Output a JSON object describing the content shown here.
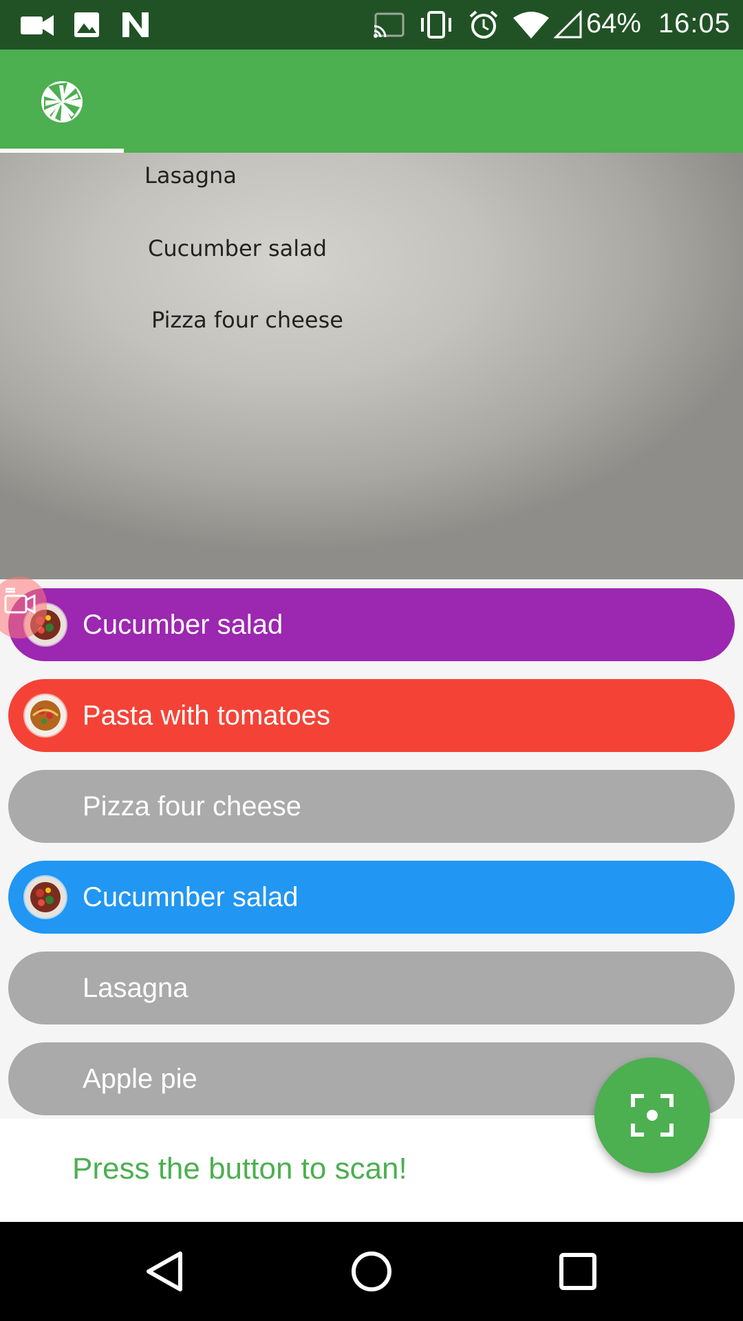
{
  "status_bar": {
    "battery": "64%",
    "time": "16:05",
    "icons": [
      "video-camera-icon",
      "gallery-icon",
      "n-logo-icon",
      "cast-icon",
      "vibrate-icon",
      "alarm-icon",
      "wifi-icon",
      "signal-icon"
    ]
  },
  "app_bar": {
    "tabs": [
      {
        "icon": "camera-aperture-icon",
        "selected": true
      }
    ],
    "color": "#4caf50"
  },
  "camera_preview": {
    "lines": [
      "Lasagna",
      "Cucumber salad",
      "Pizza four cheese"
    ]
  },
  "dishes": [
    {
      "label": "Cucumber salad",
      "color": "#9c27b0",
      "thumb": "salad"
    },
    {
      "label": "Pasta with tomatoes",
      "color": "#f44336",
      "thumb": "pasta"
    },
    {
      "label": "Pizza four cheese",
      "color": "#aaaaaa",
      "thumb": ""
    },
    {
      "label": "Cucumnber salad",
      "color": "#2196f3",
      "thumb": "salad"
    },
    {
      "label": "Lasagna",
      "color": "#aaaaaa",
      "thumb": ""
    },
    {
      "label": "Apple pie",
      "color": "#aaaaaa",
      "thumb": ""
    }
  ],
  "bottom": {
    "prompt": "Press the button to scan!"
  },
  "fab": {
    "icon": "scan-focus-icon"
  },
  "nav": {
    "icons": [
      "back-icon",
      "home-icon",
      "recents-icon"
    ]
  }
}
